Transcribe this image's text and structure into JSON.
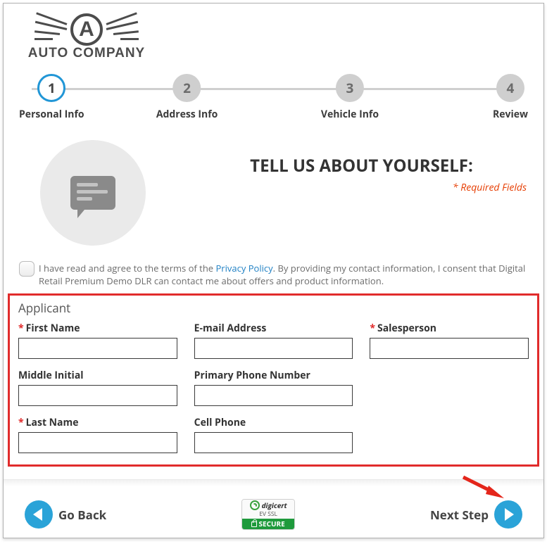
{
  "brand": {
    "letter": "A",
    "name": "AUTO COMPANY"
  },
  "steps": [
    {
      "num": "1",
      "label": "Personal Info",
      "active": true,
      "leftPct": 0,
      "align": "left"
    },
    {
      "num": "2",
      "label": "Address Info",
      "active": false,
      "leftPct": 33,
      "align": "center"
    },
    {
      "num": "3",
      "label": "Vehicle Info",
      "active": false,
      "leftPct": 65,
      "align": "center"
    },
    {
      "num": "4",
      "label": "Review",
      "active": false,
      "leftPct": 100,
      "align": "right"
    }
  ],
  "hero": {
    "title": "TELL US ABOUT YOURSELF:",
    "required_note": "* Required Fields"
  },
  "consent": {
    "pre": "I have read and agree to the terms of the ",
    "link": "Privacy Policy",
    "post": ". By providing my contact information, I consent that Digital Retail Premium Demo DLR can contact me about offers and product information."
  },
  "form": {
    "section_title": "Applicant",
    "first_name": {
      "label": "First Name",
      "required": true,
      "value": ""
    },
    "middle": {
      "label": "Middle Initial",
      "required": false,
      "value": ""
    },
    "last_name": {
      "label": "Last Name",
      "required": true,
      "value": ""
    },
    "email": {
      "label": "E-mail Address",
      "required": false,
      "value": ""
    },
    "phone": {
      "label": "Primary Phone Number",
      "required": false,
      "value": ""
    },
    "cell": {
      "label": "Cell Phone",
      "required": false,
      "value": ""
    },
    "salesperson": {
      "label": "Salesperson",
      "required": true,
      "value": ""
    }
  },
  "footer": {
    "back": "Go Back",
    "next": "Next Step",
    "badge": {
      "brand": "digicert",
      "line2": "EV SSL",
      "secure": "SECURE"
    }
  }
}
